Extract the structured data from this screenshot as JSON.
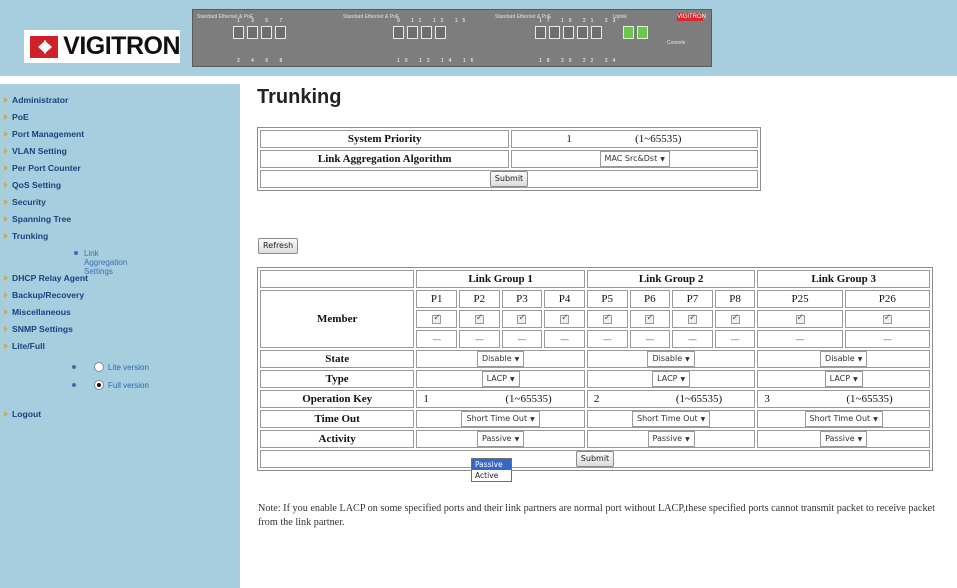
{
  "brand": {
    "logo_text": "VIGITRON",
    "accent_color": "#d0202a"
  },
  "panel": {
    "group_labels": [
      "Standard Ethernet & PoE",
      "Standard Ethernet & PoE",
      "Standard Ethernet & PoE",
      "Uplink",
      "Console"
    ],
    "badge": "VIGITRON",
    "port_numbers_top_1": "1 3 5 7",
    "port_numbers_bot_1": "2 4 6 8",
    "port_numbers_top_2": "9 11 13 15",
    "port_numbers_bot_2": "10 12 14 16",
    "port_numbers_top_3": "17 19 21 23",
    "port_numbers_bot_3": "18 20 22 24"
  },
  "sidebar": {
    "items": [
      {
        "label": "Administrator"
      },
      {
        "label": "PoE"
      },
      {
        "label": "Port Management"
      },
      {
        "label": "VLAN Setting"
      },
      {
        "label": "Per Port Counter"
      },
      {
        "label": "QoS Setting"
      },
      {
        "label": "Security"
      },
      {
        "label": "Spanning Tree"
      },
      {
        "label": "Trunking"
      },
      {
        "label": "DHCP Relay Agent"
      },
      {
        "label": "Backup/Recovery"
      },
      {
        "label": "Miscellaneous"
      },
      {
        "label": "SNMP Settings"
      },
      {
        "label": "Lite/Full"
      },
      {
        "label": "Logout"
      }
    ],
    "sub_item": "Link Aggregation Settings",
    "lite_option": "Lite version",
    "full_option": "Full version"
  },
  "page": {
    "title": "Trunking",
    "refresh_label": "Refresh"
  },
  "system": {
    "priority_label": "System Priority",
    "priority_value": "1",
    "priority_range": "(1~65535)",
    "algorithm_label": "Link Aggregation Algorithm",
    "algorithm_value": "MAC Src&Dst",
    "submit_label": "Submit"
  },
  "trunk": {
    "groups": [
      {
        "title": "Link Group 1",
        "ports": [
          "P1",
          "P2",
          "P3",
          "P4"
        ],
        "state": "Disable",
        "type": "LACP",
        "key": "1",
        "timeout": "Short Time Out",
        "activity": "Passive"
      },
      {
        "title": "Link Group 2",
        "ports": [
          "P5",
          "P6",
          "P7",
          "P8"
        ],
        "state": "Disable",
        "type": "LACP",
        "key": "2",
        "timeout": "Short Time Out",
        "activity": "Passive"
      },
      {
        "title": "Link Group 3",
        "ports": [
          "P25",
          "P26"
        ],
        "state": "Disable",
        "type": "LACP",
        "key": "3",
        "timeout": "Short Time Out",
        "activity": "Passive"
      }
    ],
    "row_labels": {
      "member": "Member",
      "state": "State",
      "type": "Type",
      "key": "Operation Key",
      "timeout": "Time Out",
      "activity": "Activity"
    },
    "key_range": "(1~65535)",
    "dash": "—",
    "submit_label": "Submit",
    "activity_options": [
      "Passive",
      "Active"
    ]
  },
  "note": "Note: If you enable LACP on some specified ports and their link partners are normal port without LACP,these specified ports cannot transmit packet to receive packet from the link partner."
}
